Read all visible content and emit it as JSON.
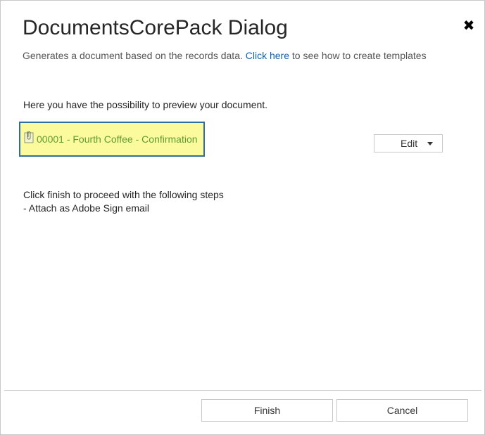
{
  "dialog": {
    "title": "DocumentsCorePack Dialog",
    "close_glyph": "✖",
    "subtitle_before": "Generates a document based on the records data.",
    "subtitle_link": "Click here",
    "subtitle_after": "to see how to create templates"
  },
  "preview": {
    "intro": "Here you have the possibility to preview your document.",
    "document_name": "00001 - Fourth Coffee - Confirmation",
    "document_icon": "attachment-icon",
    "edit_label": "Edit"
  },
  "steps": {
    "line1": "Click finish to proceed with the following steps",
    "line2": "- Attach as Adobe Sign email"
  },
  "footer": {
    "finish_label": "Finish",
    "cancel_label": "Cancel"
  },
  "colors": {
    "link": "#1160b7",
    "document_text": "#5f9b33",
    "highlight": "#fbfb9e",
    "highlight_border": "#2f6e9e"
  }
}
